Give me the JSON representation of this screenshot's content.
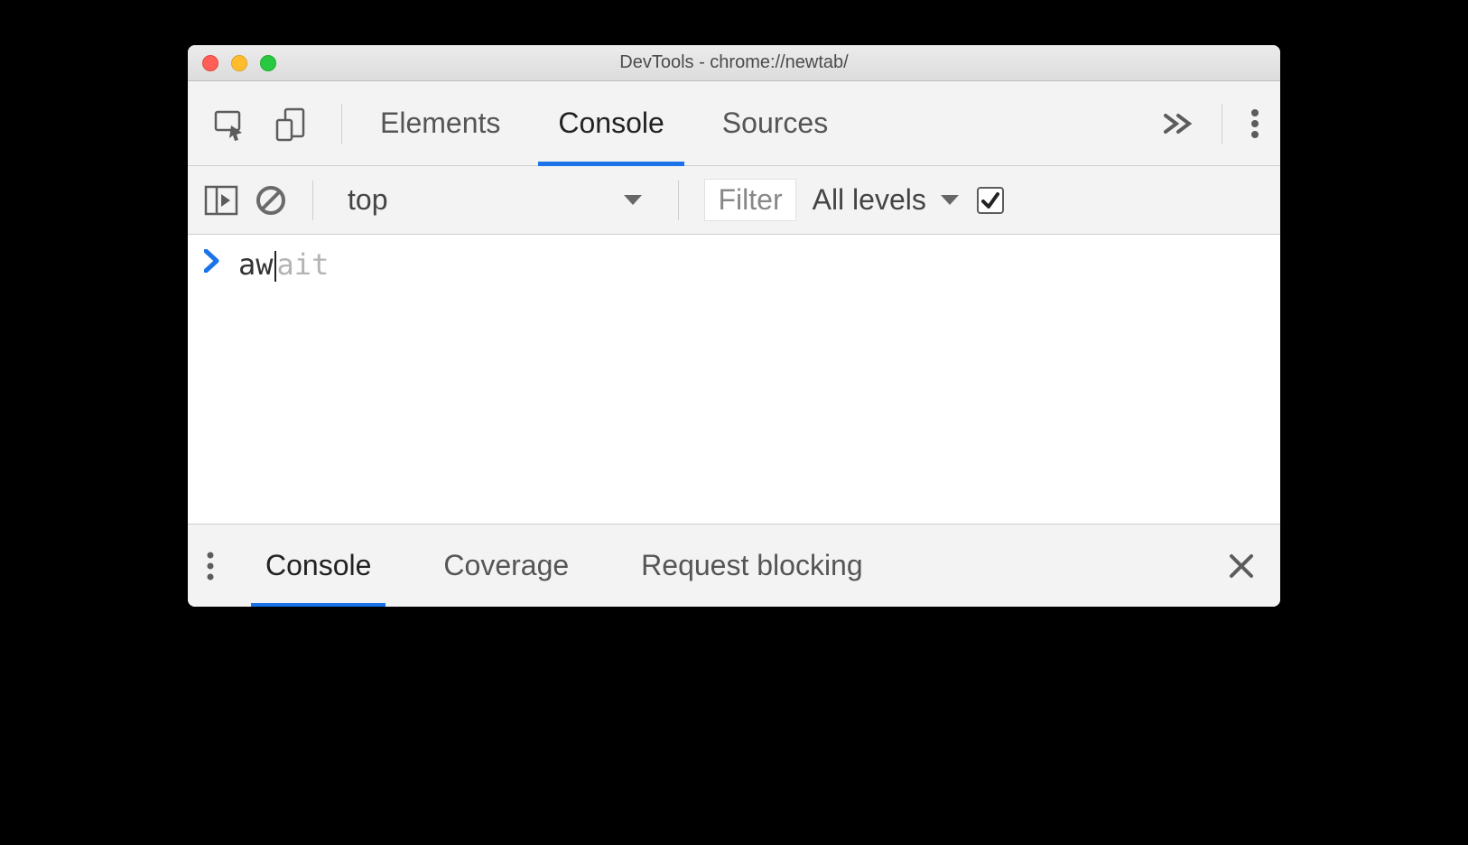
{
  "window": {
    "title": "DevTools - chrome://newtab/"
  },
  "tabs": {
    "elements": "Elements",
    "console": "Console",
    "sources": "Sources"
  },
  "toolbar": {
    "context": "top",
    "filter_placeholder": "Filter",
    "levels_label": "All levels"
  },
  "console": {
    "typed": "aw",
    "autocomplete_suffix": "ait"
  },
  "drawer": {
    "console": "Console",
    "coverage": "Coverage",
    "request_blocking": "Request blocking"
  }
}
